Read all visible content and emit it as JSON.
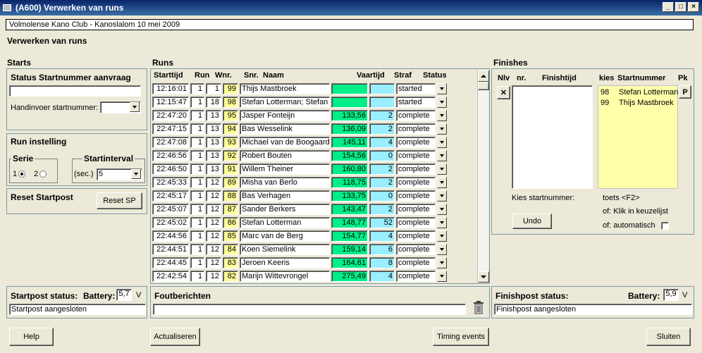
{
  "window": {
    "title": "(A600) Verwerken van runs"
  },
  "club_line": "Volmolense Kano Club -  Kanoslalom 10 mei 2009",
  "page_title": "Verwerken van runs",
  "starts": {
    "heading": "Starts",
    "status_title": "Status Startnummer aanvraag",
    "status_value": "",
    "manual_label": "Handinvoer startnummer:",
    "manual_value": "",
    "run_title": "Run instelling",
    "serie_label": "Serie",
    "serie_1": "1",
    "serie_2": "2",
    "interval_label": "Startinterval",
    "interval_unit": "(sec.)",
    "interval_value": "5",
    "reset_title": "Reset Startpost",
    "reset_button": "Reset SP",
    "post_status_label": "Startpost status:",
    "battery_label": "Battery:",
    "battery_value": "5,7",
    "battery_unit": "V",
    "post_message": "Startpost aangesloten"
  },
  "runs": {
    "heading": "Runs",
    "columns": [
      "Starttijd",
      "Run",
      "Wnr.",
      "Snr.",
      "Naam",
      "Vaartijd",
      "Straf",
      "Status"
    ],
    "rows": [
      {
        "starttijd": "12:16:01",
        "run": "1",
        "wnr": "1",
        "snr": "99",
        "naam": "Thijs Mastbroek",
        "vaartijd": "",
        "straf": "",
        "status": "started"
      },
      {
        "starttijd": "12:15:47",
        "run": "1",
        "wnr": "18",
        "snr": "98",
        "naam": "Stefan Lotterman; Stefan",
        "vaartijd": "",
        "straf": "",
        "status": "started"
      },
      {
        "starttijd": "22:47:20",
        "run": "1",
        "wnr": "13",
        "snr": "95",
        "naam": "Jasper Fonteijn",
        "vaartijd": "133,56",
        "straf": "2",
        "status": "complete"
      },
      {
        "starttijd": "22:47:15",
        "run": "1",
        "wnr": "13",
        "snr": "94",
        "naam": "Bas Wesselink",
        "vaartijd": "136,09",
        "straf": "2",
        "status": "complete"
      },
      {
        "starttijd": "22:47:08",
        "run": "1",
        "wnr": "13",
        "snr": "93",
        "naam": "Michael van de Boogaard",
        "vaartijd": "145,11",
        "straf": "4",
        "status": "complete"
      },
      {
        "starttijd": "22:46:56",
        "run": "1",
        "wnr": "13",
        "snr": "92",
        "naam": "Robert Bouten",
        "vaartijd": "154,56",
        "straf": "0",
        "status": "complete"
      },
      {
        "starttijd": "22:46:50",
        "run": "1",
        "wnr": "13",
        "snr": "91",
        "naam": "Willem Theiner",
        "vaartijd": "160,80",
        "straf": "2",
        "status": "complete"
      },
      {
        "starttijd": "22:45:33",
        "run": "1",
        "wnr": "12",
        "snr": "89",
        "naam": "Misha van Berlo",
        "vaartijd": "118,75",
        "straf": "2",
        "status": "complete"
      },
      {
        "starttijd": "22:45:17",
        "run": "1",
        "wnr": "12",
        "snr": "88",
        "naam": "Bas Verhagen",
        "vaartijd": "133,75",
        "straf": "0",
        "status": "complete"
      },
      {
        "starttijd": "22:45:07",
        "run": "1",
        "wnr": "12",
        "snr": "87",
        "naam": "Sander Berkers",
        "vaartijd": "143,47",
        "straf": "2",
        "status": "complete"
      },
      {
        "starttijd": "22:45:02",
        "run": "1",
        "wnr": "12",
        "snr": "86",
        "naam": "Stefan Lotterman",
        "vaartijd": "148,77",
        "straf": "52",
        "status": "complete"
      },
      {
        "starttijd": "22:44:56",
        "run": "1",
        "wnr": "12",
        "snr": "85",
        "naam": "Marc van de Berg",
        "vaartijd": "154,77",
        "straf": "4",
        "status": "complete"
      },
      {
        "starttijd": "22:44:51",
        "run": "1",
        "wnr": "12",
        "snr": "84",
        "naam": "Koen Siemelink",
        "vaartijd": "159,14",
        "straf": "6",
        "status": "complete"
      },
      {
        "starttijd": "22:44:45",
        "run": "1",
        "wnr": "12",
        "snr": "83",
        "naam": "Jeroen Keeris",
        "vaartijd": "164,61",
        "straf": "8",
        "status": "complete"
      },
      {
        "starttijd": "22:42:54",
        "run": "1",
        "wnr": "12",
        "snr": "82",
        "naam": "Marijn Wittevrongel",
        "vaartijd": "275,49",
        "straf": "4",
        "status": "complete"
      }
    ]
  },
  "errors": {
    "heading": "Foutberichten",
    "value": ""
  },
  "finishes": {
    "heading": "Finishes",
    "col_nlv": "Nlv",
    "col_nr": "nr.",
    "col_finishtijd": "Finishtijd",
    "col_kies": "kies",
    "col_startnummer": "Startnummer",
    "col_pk": "Pk",
    "delete_glyph": "✕",
    "pk_button": "P",
    "choices": [
      {
        "nr": "98",
        "name": "Stefan Lotterman"
      },
      {
        "nr": "99",
        "name": "Thijs Mastbroek"
      }
    ],
    "kies_label": "Kies startnummer:",
    "hint1": "toets <F2>",
    "hint2": "of: Klik in keuzelijst",
    "hint3": "of: automatisch",
    "undo_button": "Undo",
    "post_status_label": "Finishpost status:",
    "battery_label": "Battery:",
    "battery_value": "5,9",
    "battery_unit": "V",
    "post_message": "Finishpost aangesloten"
  },
  "footer": {
    "help": "Help",
    "actualiseren": "Actualiseren",
    "timing": "Timing events",
    "sluiten": "Sluiten"
  }
}
